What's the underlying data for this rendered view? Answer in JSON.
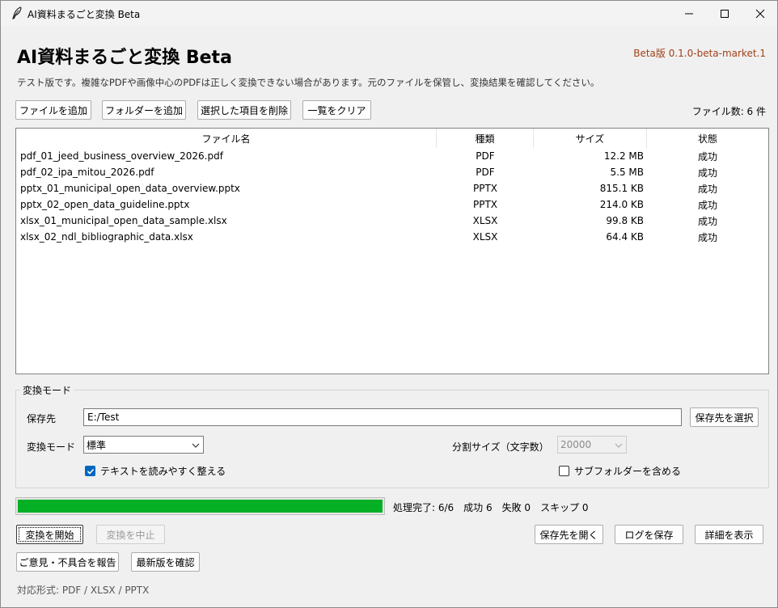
{
  "window": {
    "title": "AI資料まるごと変換 Beta"
  },
  "header": {
    "app_title": "AI資料まるごと変換 Beta",
    "version": "Beta版  0.1.0-beta-market.1",
    "description": "テスト版です。複雑なPDFや画像中心のPDFは正しく変換できない場合があります。元のファイルを保管し、変換結果を確認してください。"
  },
  "toolbar": {
    "add_file": "ファイルを追加",
    "add_folder": "フォルダーを追加",
    "remove_selected": "選択した項目を削除",
    "clear_list": "一覧をクリア",
    "file_count": "ファイル数: 6 件"
  },
  "table": {
    "columns": [
      "ファイル名",
      "種類",
      "サイズ",
      "状態"
    ],
    "rows": [
      {
        "name": "pdf_01_jeed_business_overview_2026.pdf",
        "type": "PDF",
        "size": "12.2 MB",
        "status": "成功"
      },
      {
        "name": "pdf_02_ipa_mitou_2026.pdf",
        "type": "PDF",
        "size": "5.5 MB",
        "status": "成功"
      },
      {
        "name": "pptx_01_municipal_open_data_overview.pptx",
        "type": "PPTX",
        "size": "815.1 KB",
        "status": "成功"
      },
      {
        "name": "pptx_02_open_data_guideline.pptx",
        "type": "PPTX",
        "size": "214.0 KB",
        "status": "成功"
      },
      {
        "name": "xlsx_01_municipal_open_data_sample.xlsx",
        "type": "XLSX",
        "size": "99.8 KB",
        "status": "成功"
      },
      {
        "name": "xlsx_02_ndl_bibliographic_data.xlsx",
        "type": "XLSX",
        "size": "64.4 KB",
        "status": "成功"
      }
    ]
  },
  "settings": {
    "group_label": "変換モード",
    "save_to_label": "保存先",
    "save_to_value": "E:/Test",
    "choose_dest": "保存先を選択",
    "mode_label": "変換モード",
    "mode_value": "標準",
    "split_label": "分割サイズ（文字数）",
    "split_value": "20000",
    "tidy_text": "テキストを読みやすく整える",
    "tidy_checked": true,
    "include_subfolders": "サブフォルダーを含める",
    "subfolders_checked": false
  },
  "progress": {
    "percent": 100,
    "fill_color": "#06b025",
    "status": "処理完了: 6/6　成功 6　失敗 0　スキップ 0"
  },
  "actions": {
    "start": "変換を開始",
    "stop": "変換を中止",
    "open_dest": "保存先を開く",
    "save_log": "ログを保存",
    "show_details": "詳細を表示",
    "report": "ご意見・不具合を報告",
    "check_update": "最新版を確認"
  },
  "footer": {
    "formats": "対応形式: PDF / XLSX / PPTX"
  }
}
